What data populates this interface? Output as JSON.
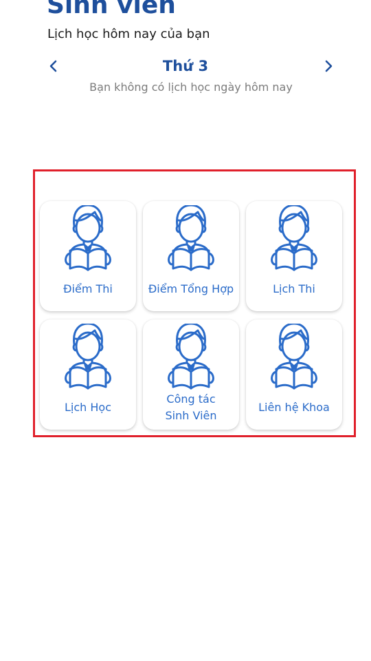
{
  "header": {
    "title": "Sinh viên",
    "subtitle": "Lịch học hôm nay của bạn"
  },
  "day_nav": {
    "prev_icon": "chevron-left-icon",
    "next_icon": "chevron-right-icon",
    "day_label": "Thứ 3"
  },
  "schedule": {
    "empty_message": "Bạn không có lịch học ngày hôm nay"
  },
  "menu": {
    "icon": "student-reading-icon",
    "accent_color": "#2a6bc9",
    "items": [
      {
        "label": "Điểm Thi"
      },
      {
        "label": "Điểm Tổng Hợp"
      },
      {
        "label": "Lịch Thi"
      },
      {
        "label": "Lịch Học"
      },
      {
        "label_line1": "Công tác",
        "label_line2": "Sinh Viên"
      },
      {
        "label": "Liên hệ Khoa"
      }
    ]
  },
  "colors": {
    "title": "#1e4f9c",
    "highlight_border": "#e0202b"
  }
}
